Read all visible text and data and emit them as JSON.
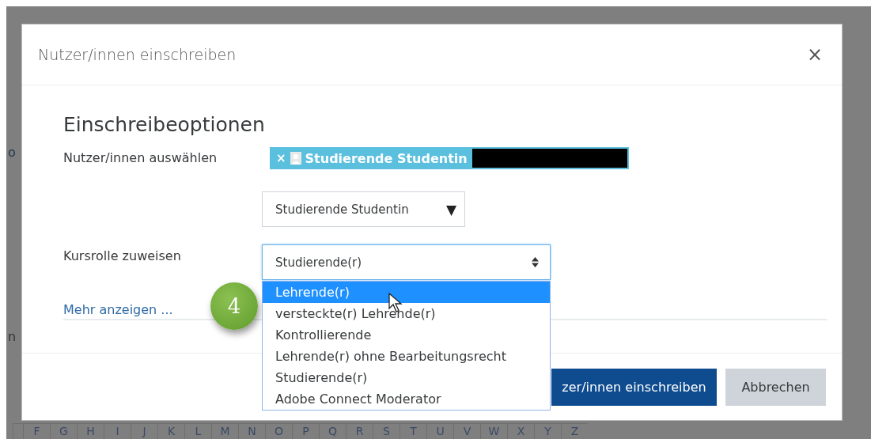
{
  "background": {
    "fragments": [
      "o",
      "n"
    ],
    "letters": [
      "F",
      "G",
      "H",
      "I",
      "J",
      "K",
      "L",
      "M",
      "N",
      "O",
      "P",
      "Q",
      "R",
      "S",
      "T",
      "U",
      "V",
      "W",
      "X",
      "Y",
      "Z"
    ]
  },
  "modal": {
    "title": "Nutzer/innen einschreiben",
    "close": "×",
    "heading": "Einschreibeoptionen",
    "select_users": {
      "label": "Nutzer/innen auswählen",
      "chip": {
        "remove": "×",
        "name": "Studierende Studentin"
      },
      "dropdown": {
        "value": "Studierende Studentin",
        "caret": "▼"
      }
    },
    "role": {
      "label": "Kursrolle zuweisen",
      "value": "Studierende(r)",
      "expanded": true,
      "options": [
        {
          "label": "Lehrende(r)",
          "highlighted": true
        },
        {
          "label": "versteckte(r) Lehrende(r)",
          "highlighted": false
        },
        {
          "label": "Kontrollierende",
          "highlighted": false
        },
        {
          "label": "Lehrende(r) ohne Bearbeitungsrecht",
          "highlighted": false
        },
        {
          "label": "Studierende(r)",
          "highlighted": false
        },
        {
          "label": "Adobe Connect Moderator",
          "highlighted": false
        }
      ]
    },
    "more_link": "Mehr anzeigen ...",
    "buttons": [
      {
        "label": "zer/innen einschreiben",
        "kind": "primary"
      },
      {
        "label": "Abbrechen",
        "kind": "secondary"
      }
    ]
  },
  "step_badge": "4"
}
